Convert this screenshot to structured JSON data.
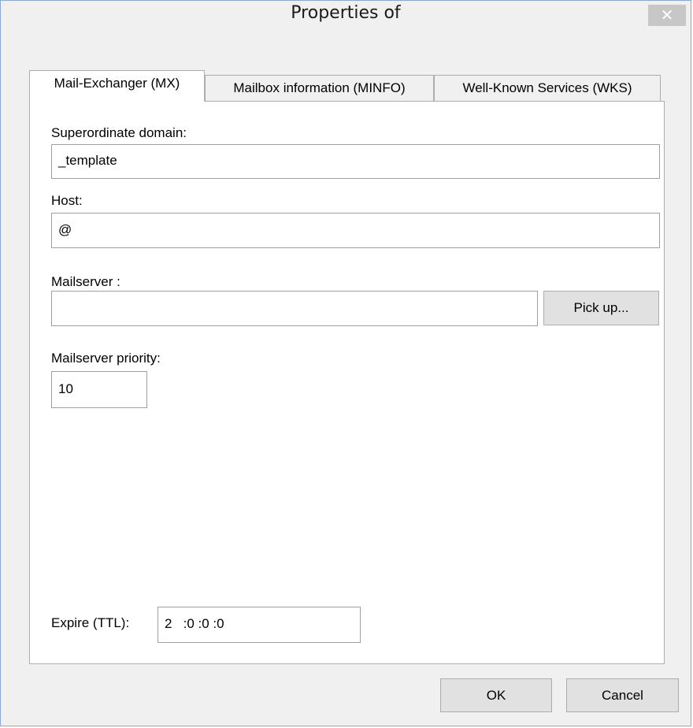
{
  "window": {
    "title": "Properties of",
    "close_glyph": "✕"
  },
  "tabs": [
    {
      "label": "Mail-Exchanger (MX)",
      "active": true
    },
    {
      "label": "Mailbox information (MINFO)",
      "active": false
    },
    {
      "label": "Well-Known Services (WKS)",
      "active": false
    }
  ],
  "form": {
    "superordinate_domain": {
      "label": "Superordinate domain:",
      "value": "_template"
    },
    "host": {
      "label": "Host:",
      "value": "@"
    },
    "mailserver": {
      "label": "Mailserver :",
      "value": "",
      "pick_label": "Pick up..."
    },
    "priority": {
      "label": "Mailserver priority:",
      "value": "10"
    },
    "expire": {
      "label": "Expire (TTL):",
      "value": "2   :0 :0 :0"
    }
  },
  "footer": {
    "ok_label": "OK",
    "cancel_label": "Cancel"
  },
  "colors": {
    "window_bg": "#f0f0f0",
    "window_border": "#8aa8d4",
    "close_bg": "#c7c7c7",
    "panel_bg": "#ffffff"
  }
}
